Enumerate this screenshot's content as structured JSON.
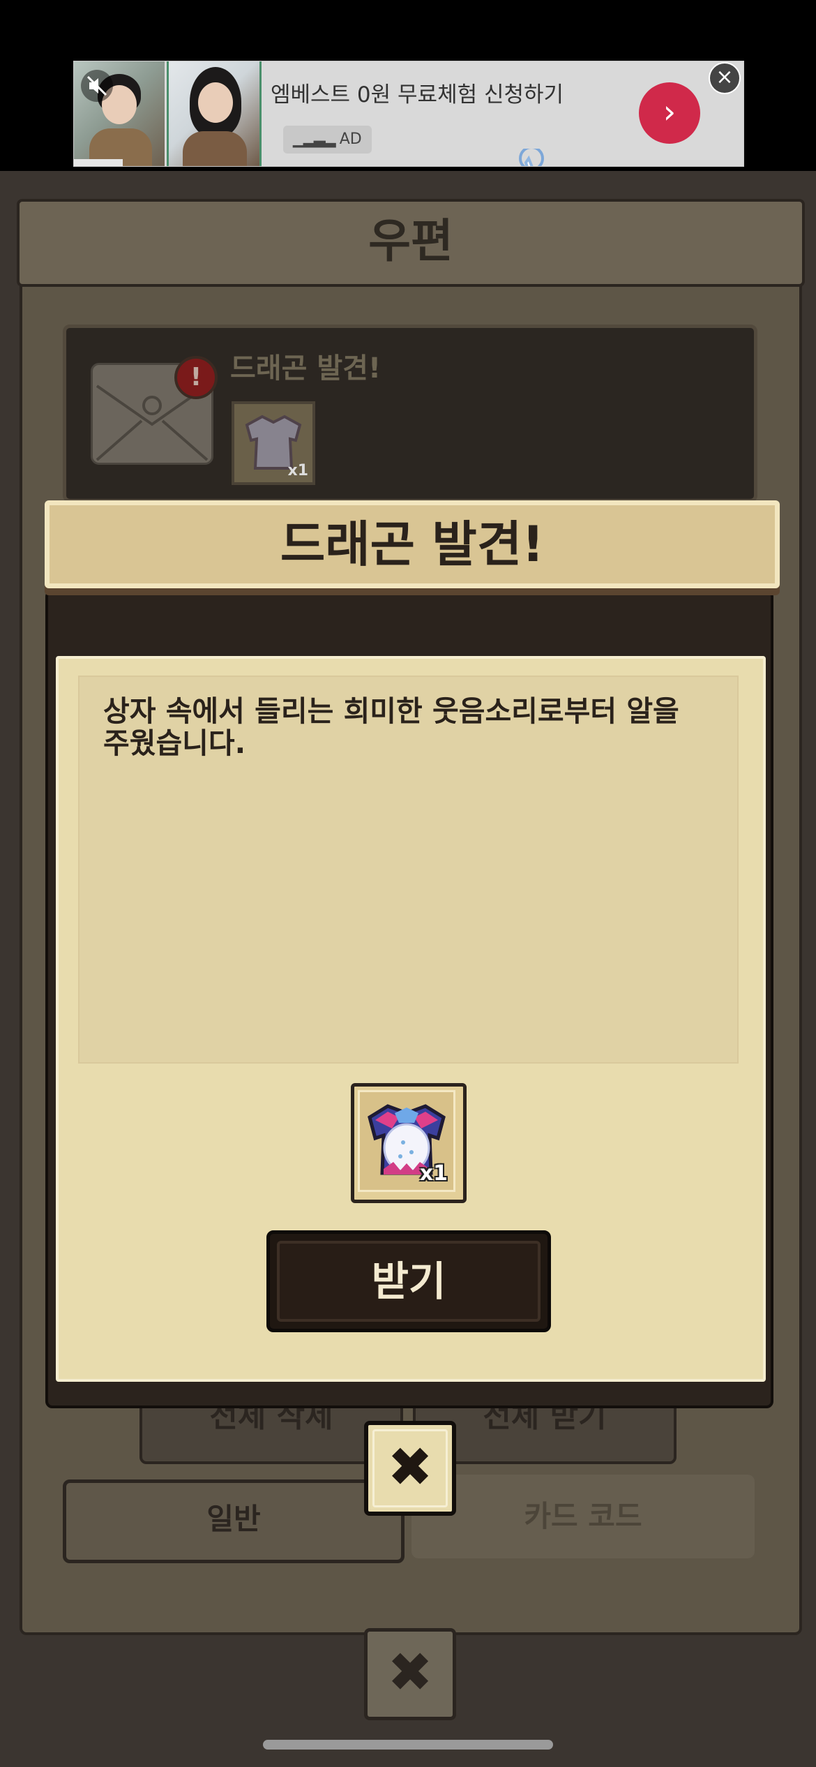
{
  "ad": {
    "title": "엠베스트 0원 무료체험 신청하기",
    "badge_label": "AD",
    "mute_icon": "mute-icon",
    "go_icon": "chevron-right-icon",
    "close_icon": "close-icon",
    "accent_color": "#d0294a"
  },
  "mail_screen": {
    "header_title": "우편",
    "mail_item": {
      "title": "드래곤 발견!",
      "reward_count": "x1"
    },
    "bottom_buttons": {
      "left": "전체 삭제",
      "right": "전체 받기"
    },
    "tabs": {
      "normal": "일반",
      "card_code": "카드 코드"
    }
  },
  "popup": {
    "title": "드래곤 발견!",
    "message": "상자 속에서 들리는 희미한 웃음소리로부터 알을 주웠습니다.",
    "reward": {
      "icon": "dragon-armor-icon",
      "count": "x1"
    },
    "receive_button": "받기",
    "close_icon": "close-icon"
  }
}
